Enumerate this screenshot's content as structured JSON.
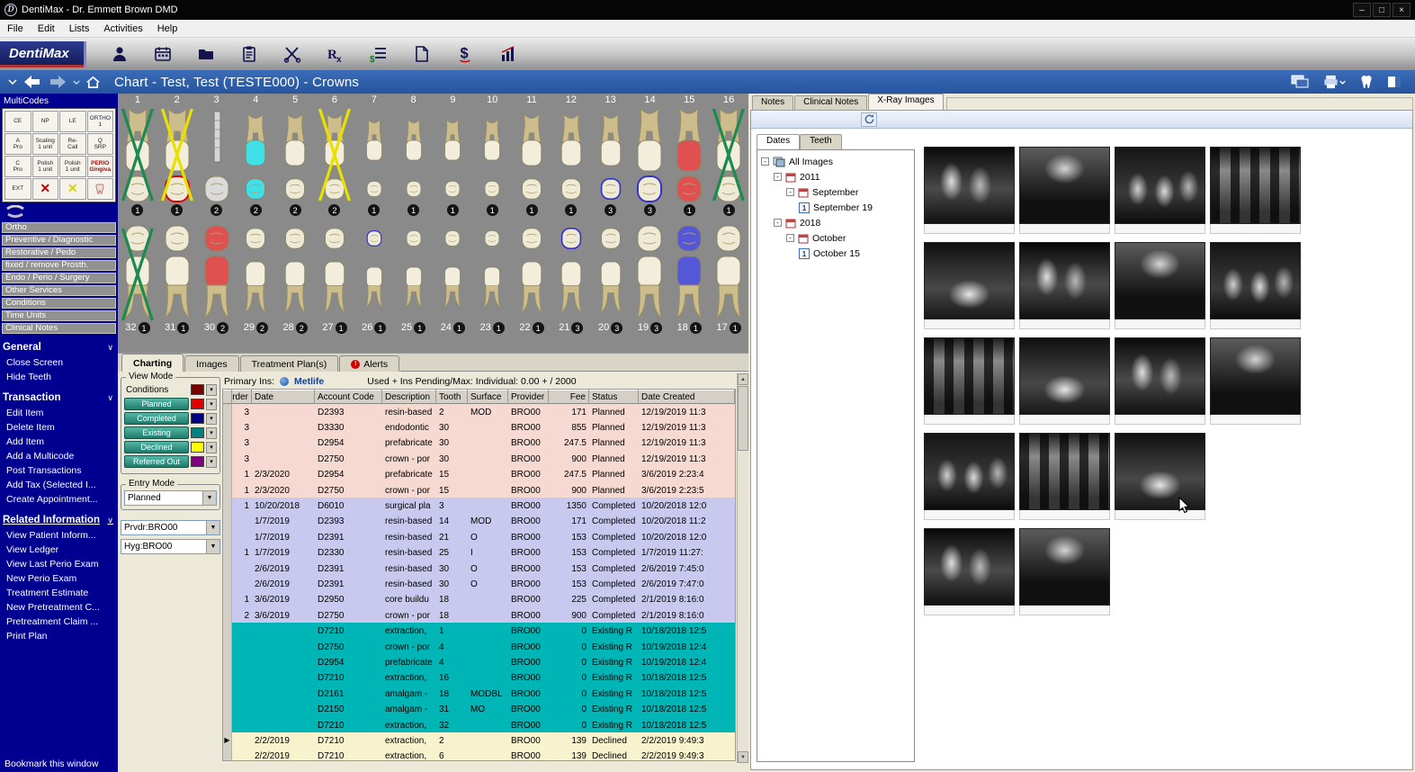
{
  "window": {
    "title": "DentiMax - Dr. Emmett Brown DMD"
  },
  "menu": [
    "File",
    "Edit",
    "Lists",
    "Activities",
    "Help"
  ],
  "toolbar": {
    "logo": "DentiMax",
    "icons": [
      "patient-icon",
      "schedule-icon",
      "folder-icon",
      "clipboard-icon",
      "extraction-icon",
      "rx-icon",
      "billing-icon",
      "document-icon",
      "payment-icon",
      "reports-icon"
    ]
  },
  "header": {
    "title": "Chart - Test, Test (TESTE000)  - Crowns"
  },
  "sidebar": {
    "multicodes_title": "MultiCodes",
    "codes": [
      {
        "label": "CE"
      },
      {
        "label": "NP"
      },
      {
        "label": "LE"
      },
      {
        "label": "ORTHO\n1",
        "kind": "ortho"
      },
      {
        "label": "A\nPro"
      },
      {
        "label": "Scaling\n1 unit"
      },
      {
        "label": "Re-\nCall"
      },
      {
        "label": "Q\nSRP"
      },
      {
        "label": "C\nPro"
      },
      {
        "label": "Polish\n1 unit"
      },
      {
        "label": "Polish\n1 unit"
      },
      {
        "label": "PERIO\nGingiva",
        "kind": "perio"
      },
      {
        "label": "EXT"
      },
      {
        "label": "✕",
        "kind": "x-red"
      },
      {
        "label": "✕",
        "kind": "x-yellow"
      },
      {
        "label": "",
        "kind": "tooth"
      }
    ],
    "categories": [
      "Ortho",
      "Preventive / Diagnostic",
      "Restorative / Pedo",
      "fixed / remove  Prosth.",
      "Endo / Perio / Surgery",
      "Other Services",
      "Conditions",
      "Time Units",
      "Clinical Notes"
    ],
    "sections": [
      {
        "title": "General",
        "underline": false,
        "items": [
          "Close Screen",
          "Hide Teeth"
        ]
      },
      {
        "title": "Transaction",
        "underline": false,
        "items": [
          "Edit Item",
          "Delete Item",
          "Add Item",
          "Add a Multicode",
          "Post Transactions",
          "Add Tax (Selected I...",
          "Create Appointment..."
        ]
      },
      {
        "title": "Related Information",
        "underline": true,
        "items": [
          "View Patient Inform...",
          "View Ledger",
          "View Last Perio Exam",
          "New Perio Exam",
          "Treatment Estimate",
          "New Pretreatment C...",
          "Pretreatment Claim ...",
          "Print Plan"
        ]
      }
    ],
    "bookmark": "Bookmark this window"
  },
  "chart": {
    "upper": [
      {
        "num": 1,
        "badge": 1,
        "x": "green"
      },
      {
        "num": 2,
        "badge": 1,
        "x": "yellow",
        "outline": "red"
      },
      {
        "num": 3,
        "badge": 2,
        "implant": true
      },
      {
        "num": 4,
        "badge": 2,
        "fill": "cyan"
      },
      {
        "num": 5,
        "badge": 2
      },
      {
        "num": 6,
        "badge": 2,
        "x": "yellow"
      },
      {
        "num": 7,
        "badge": 1
      },
      {
        "num": 8,
        "badge": 1
      },
      {
        "num": 9,
        "badge": 1
      },
      {
        "num": 10,
        "badge": 1
      },
      {
        "num": 11,
        "badge": 1
      },
      {
        "num": 12,
        "badge": 1
      },
      {
        "num": 13,
        "badge": 3,
        "outline": "blue"
      },
      {
        "num": 14,
        "badge": 3,
        "outline": "blue"
      },
      {
        "num": 15,
        "badge": 1,
        "fill": "red"
      },
      {
        "num": 16,
        "badge": 1,
        "x": "green"
      }
    ],
    "lower": [
      {
        "num": 32,
        "badge": 1,
        "x": "green"
      },
      {
        "num": 31,
        "badge": 1
      },
      {
        "num": 30,
        "badge": 2,
        "fill": "red"
      },
      {
        "num": 29,
        "badge": 2
      },
      {
        "num": 28,
        "badge": 2
      },
      {
        "num": 27,
        "badge": 1
      },
      {
        "num": 26,
        "badge": 1,
        "outline": "blue"
      },
      {
        "num": 25,
        "badge": 1
      },
      {
        "num": 24,
        "badge": 1
      },
      {
        "num": 23,
        "badge": 1
      },
      {
        "num": 22,
        "badge": 1
      },
      {
        "num": 21,
        "badge": 3,
        "outline": "blue"
      },
      {
        "num": 20,
        "badge": 3
      },
      {
        "num": 19,
        "badge": 3
      },
      {
        "num": 18,
        "badge": 1,
        "fill": "blue"
      },
      {
        "num": 17,
        "badge": 1
      }
    ]
  },
  "panel": {
    "tabs": [
      {
        "label": "Charting",
        "active": true
      },
      {
        "label": "Images",
        "active": false
      },
      {
        "label": "Treatment Plan(s)",
        "active": false
      },
      {
        "label": "Alerts",
        "active": false,
        "alert": true
      }
    ],
    "view_mode": {
      "title": "View Mode",
      "rows": [
        {
          "label": "Conditions",
          "swatch": "#7b0000",
          "button": false
        },
        {
          "label": "Planned",
          "swatch": "#e00000",
          "button": true
        },
        {
          "label": "Completed",
          "swatch": "#000080",
          "button": true
        },
        {
          "label": "Existing",
          "swatch": "#008080",
          "button": true
        },
        {
          "label": "Declined",
          "swatch": "#ffff00",
          "button": true
        },
        {
          "label": "Referred Out",
          "swatch": "#800080",
          "button": true
        }
      ]
    },
    "entry_mode": {
      "title": "Entry Mode",
      "value": "Planned",
      "provider": "Prvdr:BRO00",
      "hygienist": "Hyg:BRO00"
    },
    "insurance": {
      "label": "Primary Ins:",
      "carrier": "Metlife",
      "usage": "Used + Ins Pending/Max: Individual: 0.00 +  / 2000"
    }
  },
  "table": {
    "columns": [
      "Order",
      "Date",
      "Account Code",
      "Description",
      "Tooth",
      "Surface",
      "Provider",
      "Fee",
      "Status",
      "Date Created"
    ],
    "rows": [
      {
        "order": "3",
        "date": "",
        "code": "D2393",
        "desc": "resin-based",
        "tooth": "2",
        "surface": "MOD",
        "provider": "BRO00",
        "fee": "171",
        "status": "Planned",
        "created": "12/19/2019 11:3",
        "type": "planned"
      },
      {
        "order": "3",
        "date": "",
        "code": "D3330",
        "desc": "endodontic",
        "tooth": "30",
        "surface": "",
        "provider": "BRO00",
        "fee": "855",
        "status": "Planned",
        "created": "12/19/2019 11:3",
        "type": "planned"
      },
      {
        "order": "3",
        "date": "",
        "code": "D2954",
        "desc": "prefabricate",
        "tooth": "30",
        "surface": "",
        "provider": "BRO00",
        "fee": "247.5",
        "status": "Planned",
        "created": "12/19/2019 11:3",
        "type": "planned"
      },
      {
        "order": "3",
        "date": "",
        "code": "D2750",
        "desc": "crown - por",
        "tooth": "30",
        "surface": "",
        "provider": "BRO00",
        "fee": "900",
        "status": "Planned",
        "created": "12/19/2019 11:3",
        "type": "planned"
      },
      {
        "order": "1",
        "date": "2/3/2020",
        "code": "D2954",
        "desc": "prefabricate",
        "tooth": "15",
        "surface": "",
        "provider": "BRO00",
        "fee": "247.5",
        "status": "Planned",
        "created": "3/6/2019 2:23:4",
        "type": "planned"
      },
      {
        "order": "1",
        "date": "2/3/2020",
        "code": "D2750",
        "desc": "crown - por",
        "tooth": "15",
        "surface": "",
        "provider": "BRO00",
        "fee": "900",
        "status": "Planned",
        "created": "3/6/2019 2:23:5",
        "type": "planned"
      },
      {
        "order": "1",
        "date": "10/20/2018",
        "code": "D6010",
        "desc": "surgical pla",
        "tooth": "3",
        "surface": "",
        "provider": "BRO00",
        "fee": "1350",
        "status": "Completed",
        "created": "10/20/2018 12:0",
        "type": "completed"
      },
      {
        "order": "",
        "date": "1/7/2019",
        "code": "D2393",
        "desc": "resin-based",
        "tooth": "14",
        "surface": "MOD",
        "provider": "BRO00",
        "fee": "171",
        "status": "Completed",
        "created": "10/20/2018 11:2",
        "type": "completed"
      },
      {
        "order": "",
        "date": "1/7/2019",
        "code": "D2391",
        "desc": "resin-based",
        "tooth": "21",
        "surface": "O",
        "provider": "BRO00",
        "fee": "153",
        "status": "Completed",
        "created": "10/20/2018 12:0",
        "type": "completed"
      },
      {
        "order": "1",
        "date": "1/7/2019",
        "code": "D2330",
        "desc": "resin-based",
        "tooth": "25",
        "surface": "I",
        "provider": "BRO00",
        "fee": "153",
        "status": "Completed",
        "created": "1/7/2019 11:27:",
        "type": "completed"
      },
      {
        "order": "",
        "date": "2/6/2019",
        "code": "D2391",
        "desc": "resin-based",
        "tooth": "30",
        "surface": "O",
        "provider": "BRO00",
        "fee": "153",
        "status": "Completed",
        "created": "2/6/2019 7:45:0",
        "type": "completed"
      },
      {
        "order": "",
        "date": "2/6/2019",
        "code": "D2391",
        "desc": "resin-based",
        "tooth": "30",
        "surface": "O",
        "provider": "BRO00",
        "fee": "153",
        "status": "Completed",
        "created": "2/6/2019 7:47:0",
        "type": "completed"
      },
      {
        "order": "1",
        "date": "3/6/2019",
        "code": "D2950",
        "desc": "core buildu",
        "tooth": "18",
        "surface": "",
        "provider": "BRO00",
        "fee": "225",
        "status": "Completed",
        "created": "2/1/2019 8:16:0",
        "type": "completed"
      },
      {
        "order": "2",
        "date": "3/6/2019",
        "code": "D2750",
        "desc": "crown - por",
        "tooth": "18",
        "surface": "",
        "provider": "BRO00",
        "fee": "900",
        "status": "Completed",
        "created": "2/1/2019 8:16:0",
        "type": "completed"
      },
      {
        "order": "",
        "date": "",
        "code": "D7210",
        "desc": "extraction,",
        "tooth": "1",
        "surface": "",
        "provider": "BRO00",
        "fee": "0",
        "status": "Existing R",
        "created": "10/18/2018 12:5",
        "type": "existing"
      },
      {
        "order": "",
        "date": "",
        "code": "D2750",
        "desc": "crown - por",
        "tooth": "4",
        "surface": "",
        "provider": "BRO00",
        "fee": "0",
        "status": "Existing R",
        "created": "10/19/2018 12:4",
        "type": "existing"
      },
      {
        "order": "",
        "date": "",
        "code": "D2954",
        "desc": "prefabricate",
        "tooth": "4",
        "surface": "",
        "provider": "BRO00",
        "fee": "0",
        "status": "Existing R",
        "created": "10/19/2018 12:4",
        "type": "existing"
      },
      {
        "order": "",
        "date": "",
        "code": "D7210",
        "desc": "extraction,",
        "tooth": "16",
        "surface": "",
        "provider": "BRO00",
        "fee": "0",
        "status": "Existing R",
        "created": "10/18/2018 12:5",
        "type": "existing"
      },
      {
        "order": "",
        "date": "",
        "code": "D2161",
        "desc": "amalgam -",
        "tooth": "18",
        "surface": "MODBL",
        "provider": "BRO00",
        "fee": "0",
        "status": "Existing R",
        "created": "10/18/2018 12:5",
        "type": "existing"
      },
      {
        "order": "",
        "date": "",
        "code": "D2150",
        "desc": "amalgam -",
        "tooth": "31",
        "surface": "MO",
        "provider": "BRO00",
        "fee": "0",
        "status": "Existing R",
        "created": "10/18/2018 12:5",
        "type": "existing"
      },
      {
        "order": "",
        "date": "",
        "code": "D7210",
        "desc": "extraction,",
        "tooth": "32",
        "surface": "",
        "provider": "BRO00",
        "fee": "0",
        "status": "Existing R",
        "created": "10/18/2018 12:5",
        "type": "existing"
      },
      {
        "order": "",
        "date": "2/2/2019",
        "code": "D7210",
        "desc": "extraction,",
        "tooth": "2",
        "surface": "",
        "provider": "BRO00",
        "fee": "139",
        "status": "Declined",
        "created": "2/2/2019 9:49:3",
        "type": "declined",
        "marker": true
      },
      {
        "order": "",
        "date": "2/2/2019",
        "code": "D7210",
        "desc": "extraction,",
        "tooth": "6",
        "surface": "",
        "provider": "BRO00",
        "fee": "139",
        "status": "Declined",
        "created": "2/2/2019 9:49:3",
        "type": "declined"
      }
    ]
  },
  "xray": {
    "tabs": [
      {
        "label": "Notes",
        "active": false
      },
      {
        "label": "Clinical Notes",
        "active": false
      },
      {
        "label": "X-Ray Images",
        "active": true
      }
    ],
    "tree_tabs": [
      {
        "label": "Dates",
        "active": true
      },
      {
        "label": "Teeth",
        "active": false
      }
    ],
    "tree": [
      {
        "label": "All Images",
        "icon": "images-icon",
        "level": 0,
        "expander": true
      },
      {
        "label": "2011",
        "icon": "calendar-icon",
        "level": 1,
        "expander": true
      },
      {
        "label": "September",
        "icon": "calendar-icon",
        "level": 2,
        "expander": true
      },
      {
        "label": "September 19",
        "icon": "count-1",
        "level": 3,
        "expander": false
      },
      {
        "label": "2018",
        "icon": "calendar-icon",
        "level": 1,
        "expander": true
      },
      {
        "label": "October",
        "icon": "calendar-icon",
        "level": 2,
        "expander": true
      },
      {
        "label": "October 15",
        "icon": "count-1",
        "level": 3,
        "expander": false
      }
    ],
    "thumb_rows": [
      4,
      4,
      4,
      3,
      2
    ]
  }
}
